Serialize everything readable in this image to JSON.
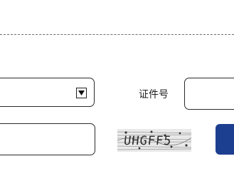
{
  "form": {
    "id_type_select": {
      "selected_value": "",
      "arrow_icon": "dropdown-arrow-icon"
    },
    "id_number": {
      "label": "证件号",
      "value": "",
      "placeholder": ""
    },
    "verification_code": {
      "value": "",
      "placeholder": ""
    },
    "captcha": {
      "text": "UHGFF5"
    },
    "submit": {
      "label": "",
      "color": "#1d3f8f"
    }
  }
}
